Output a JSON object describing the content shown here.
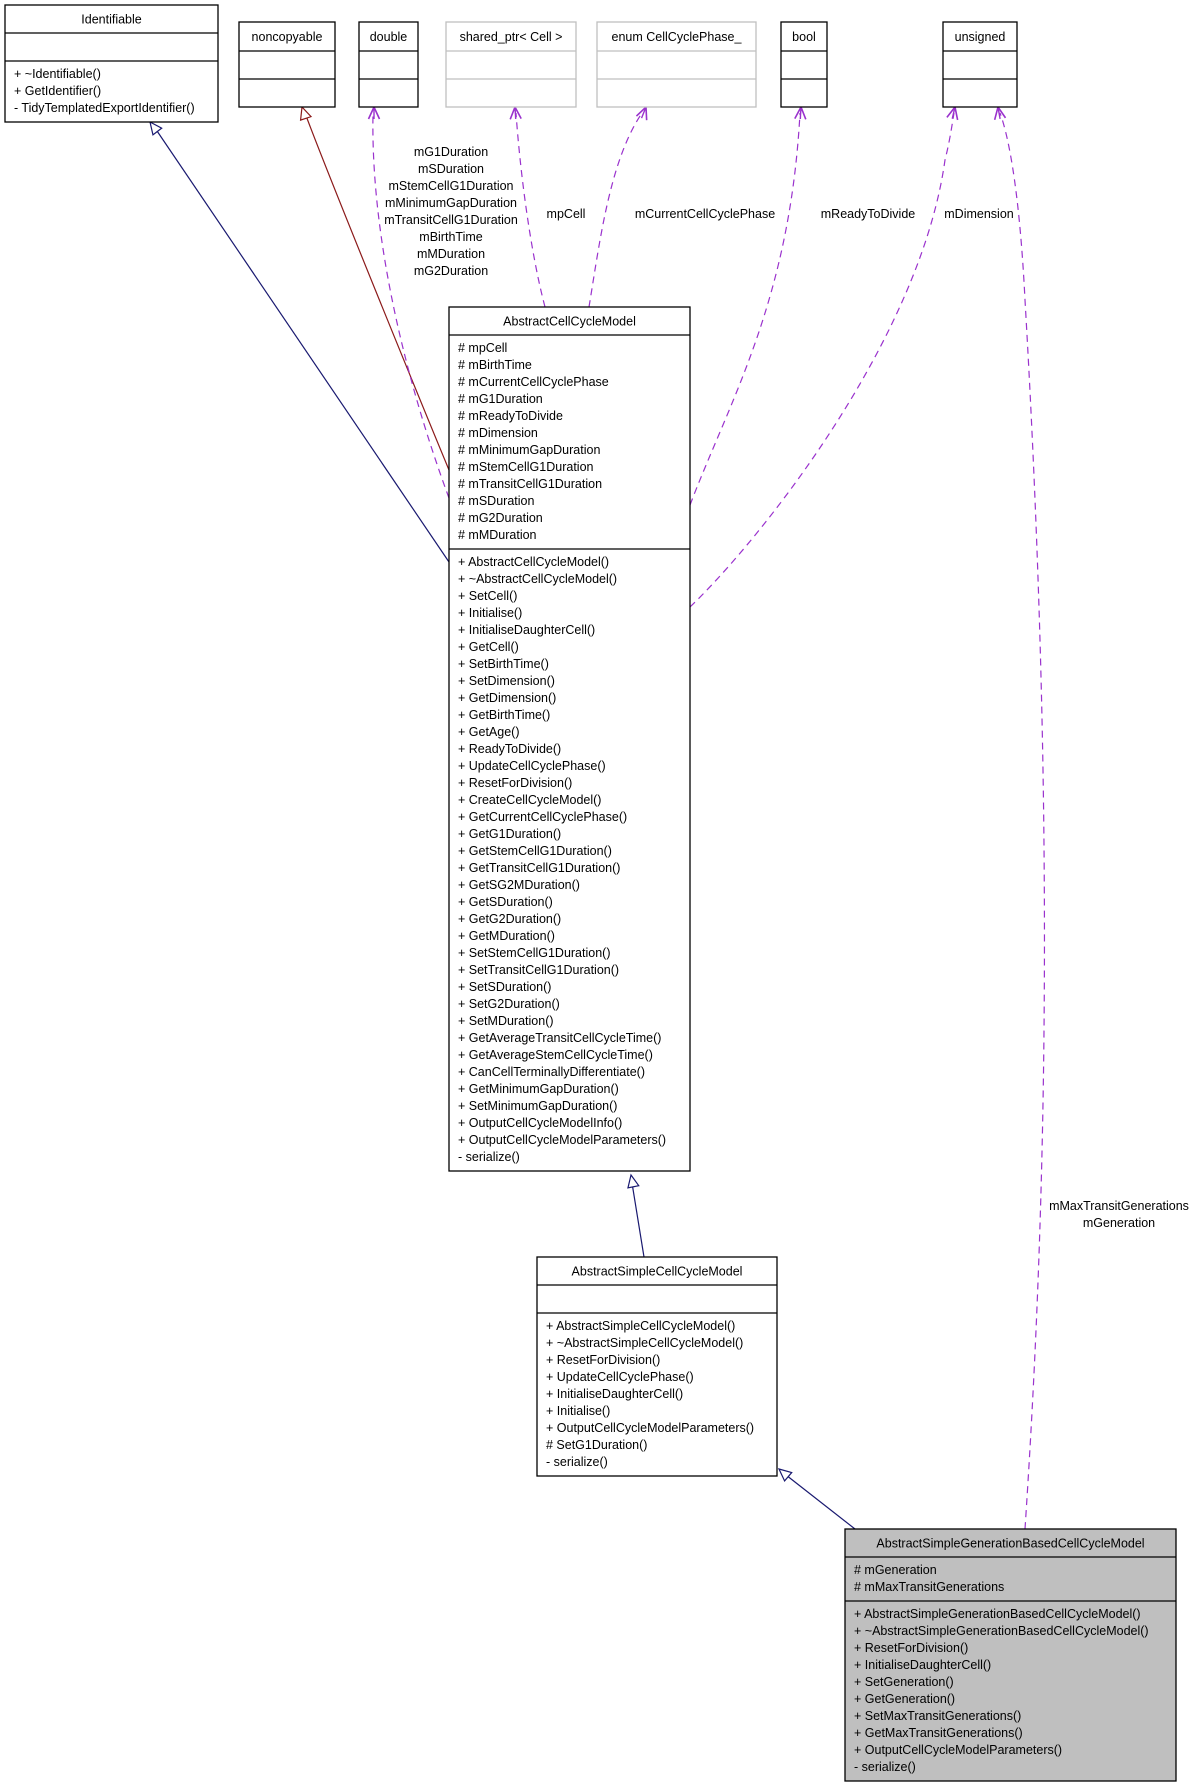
{
  "diagram": {
    "type": "uml-class-collaboration-diagram",
    "colors": {
      "inheritance_public": "#191970",
      "inheritance_private": "#8b1a1a",
      "usage": "#9a32cd",
      "box_border": "#000000",
      "external_box_border": "#bfbfbf",
      "highlight_fill": "#bfbfbf"
    },
    "classes": [
      {
        "id": "identifiable",
        "name": "Identifiable",
        "attributes": [],
        "methods": [
          "+ ~Identifiable()",
          "+ GetIdentifier()",
          "- TidyTemplatedExportIdentifier()"
        ]
      },
      {
        "id": "noncopyable",
        "name": "noncopyable",
        "attributes": [],
        "methods": []
      },
      {
        "id": "double",
        "name": "double",
        "attributes": [],
        "methods": []
      },
      {
        "id": "shared_ptr",
        "name": "shared_ptr< Cell >",
        "attributes": [],
        "methods": [],
        "external": true
      },
      {
        "id": "enum_phase",
        "name": "enum CellCyclePhase_",
        "attributes": [],
        "methods": [],
        "external": true
      },
      {
        "id": "bool",
        "name": "bool",
        "attributes": [],
        "methods": []
      },
      {
        "id": "unsigned",
        "name": "unsigned",
        "attributes": [],
        "methods": []
      },
      {
        "id": "abstract_ccm",
        "name": "AbstractCellCycleModel",
        "attributes": [
          "# mpCell",
          "# mBirthTime",
          "# mCurrentCellCyclePhase",
          "# mG1Duration",
          "# mReadyToDivide",
          "# mDimension",
          "# mMinimumGapDuration",
          "# mStemCellG1Duration",
          "# mTransitCellG1Duration",
          "# mSDuration",
          "# mG2Duration",
          "# mMDuration"
        ],
        "methods": [
          "+ AbstractCellCycleModel()",
          "+ ~AbstractCellCycleModel()",
          "+ SetCell()",
          "+ Initialise()",
          "+ InitialiseDaughterCell()",
          "+ GetCell()",
          "+ SetBirthTime()",
          "+ SetDimension()",
          "+ GetDimension()",
          "+ GetBirthTime()",
          "+ GetAge()",
          "+ ReadyToDivide()",
          "+ UpdateCellCyclePhase()",
          "+ ResetForDivision()",
          "+ CreateCellCycleModel()",
          "+ GetCurrentCellCyclePhase()",
          "+ GetG1Duration()",
          "+ GetStemCellG1Duration()",
          "+ GetTransitCellG1Duration()",
          "+ GetSG2MDuration()",
          "+ GetSDuration()",
          "+ GetG2Duration()",
          "+ GetMDuration()",
          "+ SetStemCellG1Duration()",
          "+ SetTransitCellG1Duration()",
          "+ SetSDuration()",
          "+ SetG2Duration()",
          "+ SetMDuration()",
          "+ GetAverageTransitCellCycleTime()",
          "+ GetAverageStemCellCycleTime()",
          "+ CanCellTerminallyDifferentiate()",
          "+ GetMinimumGapDuration()",
          "+ SetMinimumGapDuration()",
          "+ OutputCellCycleModelInfo()",
          "+ OutputCellCycleModelParameters()",
          "- serialize()"
        ]
      },
      {
        "id": "abstract_simple_ccm",
        "name": "AbstractSimpleCellCycleModel",
        "attributes": [],
        "methods": [
          "+ AbstractSimpleCellCycleModel()",
          "+ ~AbstractSimpleCellCycleModel()",
          "+ ResetForDivision()",
          "+ UpdateCellCyclePhase()",
          "+ InitialiseDaughterCell()",
          "+ Initialise()",
          "+ OutputCellCycleModelParameters()",
          "# SetG1Duration()",
          "- serialize()"
        ]
      },
      {
        "id": "abstract_simple_gen_ccm",
        "name": "AbstractSimpleGenerationBasedCellCycleModel",
        "highlighted": true,
        "attributes": [
          "# mGeneration",
          "# mMaxTransitGenerations"
        ],
        "methods": [
          "+ AbstractSimpleGenerationBasedCellCycleModel()",
          "+ ~AbstractSimpleGenerationBasedCellCycleModel()",
          "+ ResetForDivision()",
          "+ InitialiseDaughterCell()",
          "+ SetGeneration()",
          "+ GetGeneration()",
          "+ SetMaxTransitGenerations()",
          "+ GetMaxTransitGenerations()",
          "+ OutputCellCycleModelParameters()",
          "- serialize()"
        ]
      }
    ],
    "edges": [
      {
        "id": "e-identifiable",
        "from": "abstract_ccm",
        "to": "identifiable",
        "kind": "inheritance_public",
        "labels": []
      },
      {
        "id": "e-noncopyable",
        "from": "abstract_ccm",
        "to": "noncopyable",
        "kind": "inheritance_private",
        "labels": []
      },
      {
        "id": "e-double",
        "from": "abstract_ccm",
        "to": "double",
        "kind": "usage",
        "labels": [
          "mG1Duration",
          "mSDuration",
          "mStemCellG1Duration",
          "mMinimumGapDuration",
          "mTransitCellG1Duration",
          "mBirthTime",
          "mMDuration",
          "mG2Duration"
        ]
      },
      {
        "id": "e-shared_ptr",
        "from": "abstract_ccm",
        "to": "shared_ptr",
        "kind": "usage",
        "labels": [
          "mpCell"
        ]
      },
      {
        "id": "e-enum",
        "from": "abstract_ccm",
        "to": "enum_phase",
        "kind": "usage",
        "labels": [
          "mCurrentCellCyclePhase"
        ]
      },
      {
        "id": "e-bool",
        "from": "abstract_ccm",
        "to": "bool",
        "kind": "usage",
        "labels": [
          "mReadyToDivide"
        ]
      },
      {
        "id": "e-unsigned-dim",
        "from": "abstract_ccm",
        "to": "unsigned",
        "kind": "usage",
        "labels": [
          "mDimension"
        ]
      },
      {
        "id": "e-simple",
        "from": "abstract_simple_ccm",
        "to": "abstract_ccm",
        "kind": "inheritance_public",
        "labels": []
      },
      {
        "id": "e-gen",
        "from": "abstract_simple_gen_ccm",
        "to": "abstract_simple_ccm",
        "kind": "inheritance_public",
        "labels": []
      },
      {
        "id": "e-unsigned-gen",
        "from": "abstract_simple_gen_ccm",
        "to": "unsigned",
        "kind": "usage",
        "labels": [
          "mMaxTransitGenerations",
          "mGeneration"
        ]
      }
    ]
  }
}
